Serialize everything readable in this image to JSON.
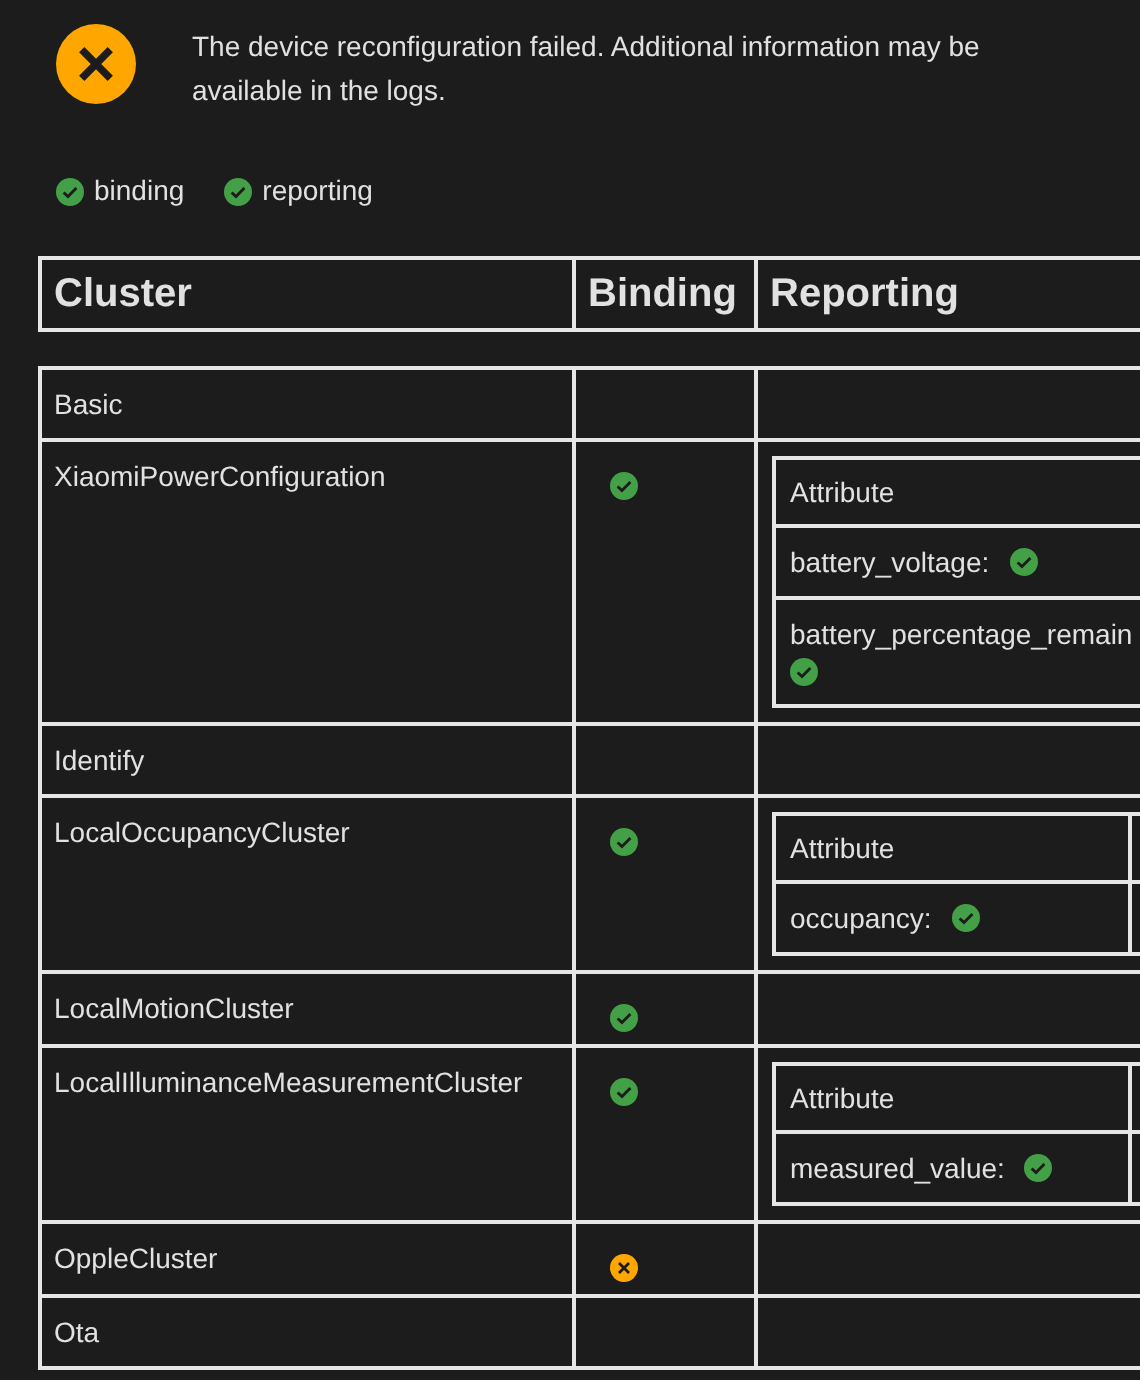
{
  "alert": {
    "kind": "error",
    "message": "The device reconfiguration failed. Additional information may be available in the logs."
  },
  "legend": [
    {
      "label": "binding",
      "success": true
    },
    {
      "label": "reporting",
      "success": true
    }
  ],
  "table": {
    "columns": [
      "Cluster",
      "Binding",
      "Reporting"
    ],
    "rows": [
      {
        "cluster": "Basic"
      },
      {
        "cluster": "XiaomiPowerConfiguration",
        "binding_success": true,
        "reporting": {
          "header": "Attribute",
          "attributes": [
            {
              "name": "battery_voltage:",
              "success": true
            },
            {
              "name": "battery_percentage_remain",
              "success": true
            }
          ]
        }
      },
      {
        "cluster": "Identify"
      },
      {
        "cluster": "LocalOccupancyCluster",
        "binding_success": true,
        "reporting": {
          "header": "Attribute",
          "attributes": [
            {
              "name": "occupancy:",
              "success": true
            }
          ]
        }
      },
      {
        "cluster": "LocalMotionCluster",
        "binding_success": true
      },
      {
        "cluster": "LocalIlluminanceMeasurementCluster",
        "binding_success": true,
        "reporting": {
          "header": "Attribute",
          "attributes": [
            {
              "name": "measured_value:",
              "success": true
            }
          ]
        }
      },
      {
        "cluster": "OppleCluster",
        "binding_success": false
      },
      {
        "cluster": "Ota"
      }
    ]
  }
}
